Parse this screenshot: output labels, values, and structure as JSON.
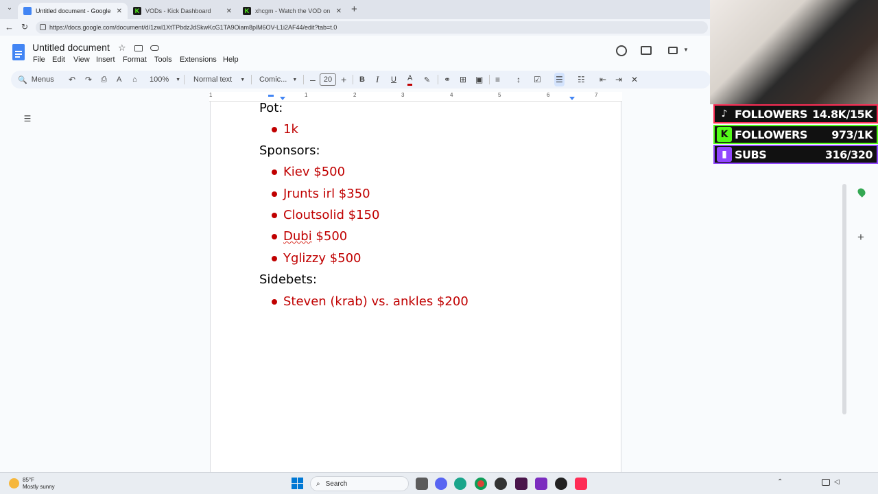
{
  "browser": {
    "tabs": [
      {
        "title": "Untitled document - Google Docs",
        "icon": "docs-icon",
        "active": true
      },
      {
        "title": "VODs - Kick Dashboard",
        "icon": "kick-icon",
        "active": false
      },
      {
        "title": "xhcgm - Watch the VOD on Kick",
        "icon": "kick-icon",
        "active": false
      }
    ],
    "url": "https://docs.google.com/document/d/1zwl1XtTPbdzJdSkwKcG1TA9Oiam8plM6OV-L1i2AF44/edit?tab=t.0"
  },
  "docs": {
    "title": "Untitled document",
    "menus": [
      "File",
      "Edit",
      "View",
      "Insert",
      "Format",
      "Tools",
      "Extensions",
      "Help"
    ],
    "toolbar": {
      "menus_search": "Menus",
      "zoom": "100%",
      "style": "Normal text",
      "font": "Comic...",
      "font_size": "20"
    },
    "ruler_numbers": [
      "1",
      "1",
      "2",
      "3",
      "4",
      "5",
      "6",
      "7"
    ]
  },
  "document": {
    "sections": [
      {
        "heading": "Pot:",
        "items": [
          "1k"
        ]
      },
      {
        "heading": "Sponsors:",
        "items": [
          "Kiev $500",
          "Jrunts irl $350",
          "Cloutsolid $150",
          "Dubi $500",
          "Yglizzy $500"
        ]
      },
      {
        "heading": "Sidebets:",
        "items": [
          "Steven (krab) vs. ankles $200"
        ]
      }
    ],
    "dubi_word": "Dubi",
    "dubi_rest": " $500"
  },
  "overlay": {
    "stats": [
      {
        "label": "FOLLOWERS",
        "value": "14.8K/15K",
        "icon": "tiktok-icon",
        "color": "#fe2c55"
      },
      {
        "label": "FOLLOWERS",
        "value": "973/1K",
        "icon": "kick-icon",
        "color": "#53fc18"
      },
      {
        "label": "SUBS",
        "value": "316/320",
        "icon": "twitch-icon",
        "color": "#9146ff"
      }
    ]
  },
  "taskbar": {
    "weather_temp": "85°F",
    "weather_desc": "Mostly sunny",
    "search_label": "Search"
  }
}
